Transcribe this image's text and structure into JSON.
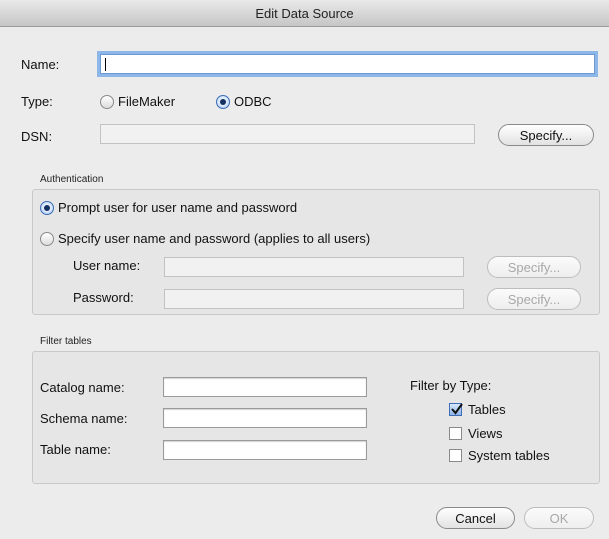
{
  "window": {
    "title": "Edit Data Source"
  },
  "name_field": {
    "label": "Name:",
    "value": ""
  },
  "type": {
    "label": "Type:",
    "options": [
      "FileMaker",
      "ODBC"
    ],
    "selected": "ODBC"
  },
  "dsn": {
    "label": "DSN:",
    "value": "",
    "specify_label": "Specify..."
  },
  "authentication": {
    "title": "Authentication",
    "option_prompt": "Prompt user for user name and password",
    "option_specify": "Specify user name and password (applies to all users)",
    "selected": "prompt",
    "username_label": "User name:",
    "password_label": "Password:",
    "specify_label": "Specify..."
  },
  "filter": {
    "title": "Filter tables",
    "catalog_label": "Catalog name:",
    "schema_label": "Schema name:",
    "table_label": "Table name:",
    "by_type_label": "Filter by Type:",
    "tables_label": "Tables",
    "tables_checked": true,
    "views_label": "Views",
    "views_checked": false,
    "system_label": "System tables",
    "system_checked": false
  },
  "footer": {
    "cancel_label": "Cancel",
    "ok_label": "OK"
  }
}
